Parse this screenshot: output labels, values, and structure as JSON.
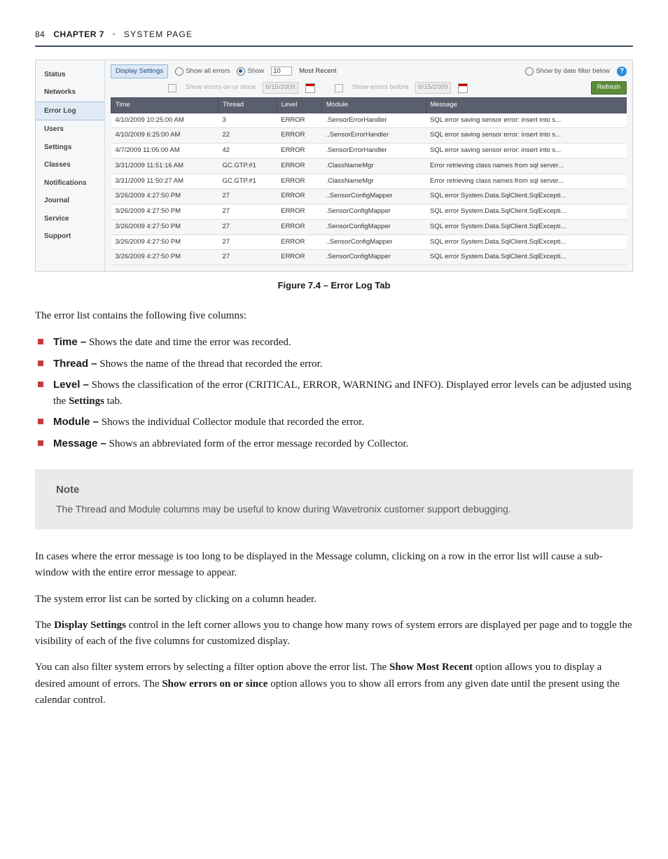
{
  "header": {
    "page_number": "84",
    "chapter": "CHAPTER 7",
    "separator": "▫",
    "title": "SYSTEM PAGE"
  },
  "shot": {
    "nav": [
      "Status",
      "Networks",
      "Error Log",
      "Users",
      "Settings",
      "Classes",
      "Notifications",
      "Journal",
      "Service",
      "Support"
    ],
    "nav_selected": "Error Log",
    "display_settings": "Display Settings",
    "show_all": "Show all errors",
    "show_n": "Show",
    "show_count": "10",
    "most_recent": "Most Recent",
    "show_by_date": "Show by date filter below",
    "on_since": "Show errors on or since",
    "on_since_date": "6/15/2009",
    "before": "Show errors before",
    "before_date": "6/15/2009",
    "refresh": "Refresh",
    "help": "?",
    "cols": [
      "Time",
      "Thread",
      "Level",
      "Module",
      "Message"
    ],
    "rows": [
      [
        "4/10/2009 10:25:00 AM",
        "3",
        "ERROR",
        ".SensorErrorHandler",
        "SQL error saving sensor error: insert into s..."
      ],
      [
        "4/10/2009 6:25:00 AM",
        "22",
        "ERROR",
        "..SensorErrorHandler",
        "SQL error saving sensor error: insert into s..."
      ],
      [
        "4/7/2009 11:05:00 AM",
        "42",
        "ERROR",
        ".SensorErrorHandler",
        "SQL error saving sensor error: insert into s..."
      ],
      [
        "3/31/2009 11:51:16 AM",
        "GC.GTP.#1",
        "ERROR",
        ".ClassNameMgr",
        "Error retrieving class names from sql server..."
      ],
      [
        "3/31/2009 11:50:27 AM",
        "GC.GTP.#1",
        "ERROR",
        ".ClassNameMgr",
        "Error retrieving class names from sql server..."
      ],
      [
        "3/26/2009 4:27:50 PM",
        "27",
        "ERROR",
        "..SensorConfigMapper",
        "SQL error System.Data.SqlClient.SqlExcepti..."
      ],
      [
        "3/26/2009 4:27:50 PM",
        "27",
        "ERROR",
        ".SensorConfigMapper",
        "SQL error System.Data.SqlClient.SqlExcepti..."
      ],
      [
        "3/26/2009 4:27:50 PM",
        "27",
        "ERROR",
        ".SensorConfigMapper",
        "SQL error System.Data.SqlClient.SqlExcepti..."
      ],
      [
        "3/26/2009 4:27:50 PM",
        "27",
        "ERROR",
        "..SensorConfigMapper",
        "SQL error System.Data.SqlClient.SqlExcepti..."
      ],
      [
        "3/26/2009 4:27:50 PM",
        "27",
        "ERROR",
        ".SensorConfigMapper",
        "SQL error System.Data.SqlClient.SqlExcepti..."
      ]
    ]
  },
  "figcap": "Figure 7.4 – Error Log Tab",
  "intro": "The error list contains the following five columns:",
  "bullets": {
    "time_b": "Time –",
    "time_t": " Shows the date and time the error was recorded.",
    "thread_b": "Thread –",
    "thread_t": " Shows the name of the thread that recorded the error.",
    "level_b": "Level –",
    "level_t1": " Shows the classification of the error (CRITICAL, ERROR, WARNING and INFO). Displayed error levels can be adjusted using the ",
    "level_settings": "Settings",
    "level_t2": " tab.",
    "module_b": "Module –",
    "module_t": " Shows the individual Collector module that recorded the error.",
    "message_b": "Message –",
    "message_t": " Shows an abbreviated form of the error message recorded by Collector."
  },
  "note": {
    "title": "Note",
    "body": "The Thread and Module columns may be useful to know during Wavetronix customer support debugging."
  },
  "p1": "In cases where the error message is too long to be displayed in the Message column, clicking on a row in the error list will cause a sub-window with the entire error message to appear.",
  "p2": "The system error list can be sorted by clicking on a column header.",
  "p3a": "The ",
  "p3b": "Display Settings",
  "p3c": " control in the left corner allows you to change how many rows of system errors are displayed per page and to toggle the visibility of each of the five columns for customized display.",
  "p4a": "You can also filter system errors by selecting a filter option above the error list.  The ",
  "p4b": "Show Most Recent",
  "p4c": " option allows you to display a desired amount of errors. The ",
  "p4d": "Show errors on or since",
  "p4e": " option allows you to show all errors from any given date until the present using the calendar control."
}
